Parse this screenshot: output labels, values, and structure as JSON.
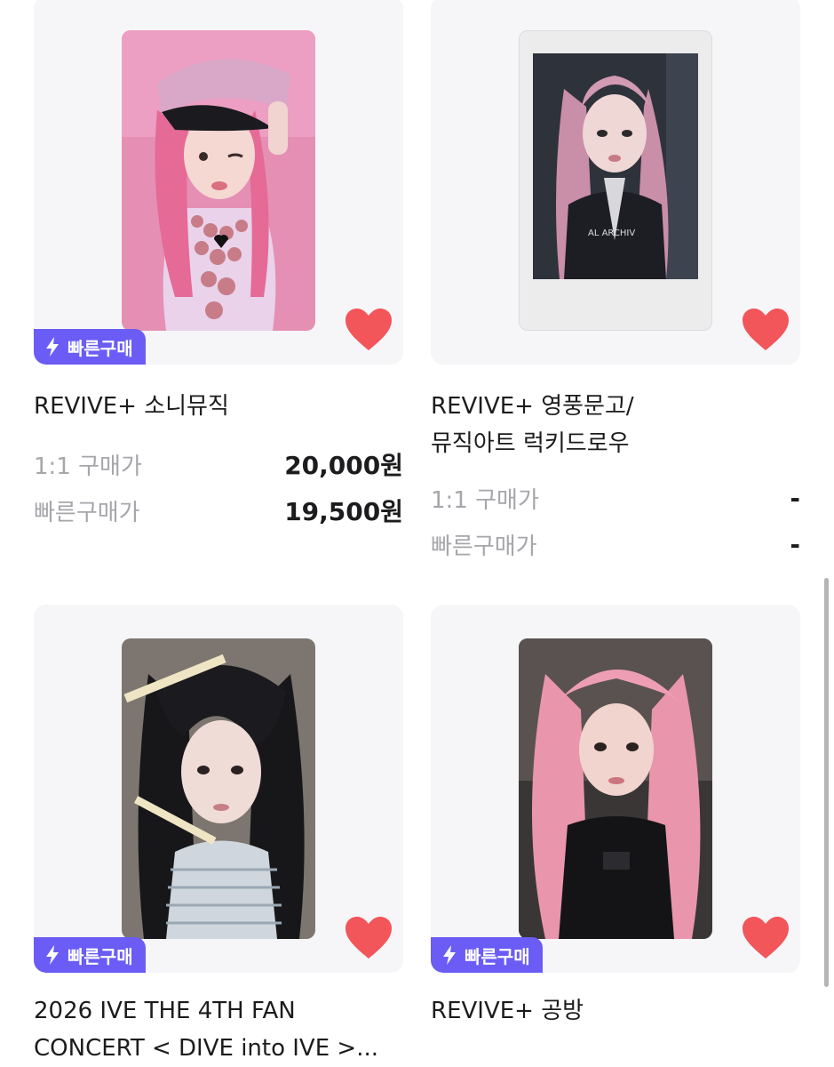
{
  "badge_label": "빠른구매",
  "label_1to1": "1:1 구매가",
  "label_quick": "빠른구매가",
  "colors": {
    "accent": "#6a5cf5",
    "heart": "#f2555a",
    "label": "#a6a6ab"
  },
  "items": [
    {
      "title": "REVIVE+ 소니뮤직",
      "price_1to1": "20,000원",
      "price_quick": "19,500원",
      "liked": true
    },
    {
      "title": "REVIVE+ 영풍문고/\n뮤직아트 럭키드로우",
      "price_1to1": "-",
      "price_quick": "-",
      "liked": true
    },
    {
      "title": "2026 IVE THE 4TH FAN\nCONCERT < DIVE into IVE >...",
      "liked": true
    },
    {
      "title": "REVIVE+ 공방",
      "liked": true
    }
  ]
}
